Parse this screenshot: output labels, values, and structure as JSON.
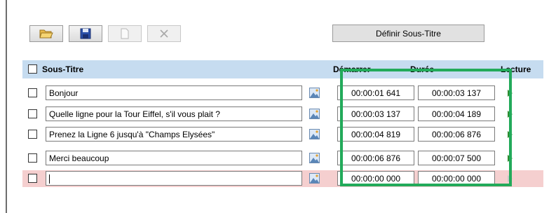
{
  "toolbar": {
    "open_icon": "open-folder-icon",
    "save_icon": "save-disk-icon",
    "new_icon": "new-document-icon",
    "delete_icon": "delete-x-icon",
    "define_subtitle_label": "Définir Sous-Titre"
  },
  "table": {
    "columns": {
      "subtitle": "Sous-Titre",
      "start": "Démarrer",
      "duration": "Durée",
      "playback": "Lecture"
    },
    "rows": [
      {
        "text": "Bonjour",
        "start": "00:00:01 641",
        "duration": "00:00:03 137"
      },
      {
        "text": "Quelle ligne pour la Tour Eiffel, s'il vous plait ?",
        "start": "00:00:03 137",
        "duration": "00:00:04 189"
      },
      {
        "text": "Prenez la Ligne 6 jusqu'à \"Champs Elysées\"",
        "start": "00:00:04 819",
        "duration": "00:00:06 876"
      },
      {
        "text": "Merci beaucoup",
        "start": "00:00:06 876",
        "duration": "00:00:07 500"
      },
      {
        "text": "",
        "start": "00:00:00 000",
        "duration": "00:00:00 000"
      }
    ]
  },
  "colors": {
    "header_bg": "#c6dcf0",
    "active_row_bg": "#f5cfcf",
    "highlight_border": "#22aa5a",
    "play_icon": "#2e8b2e"
  }
}
